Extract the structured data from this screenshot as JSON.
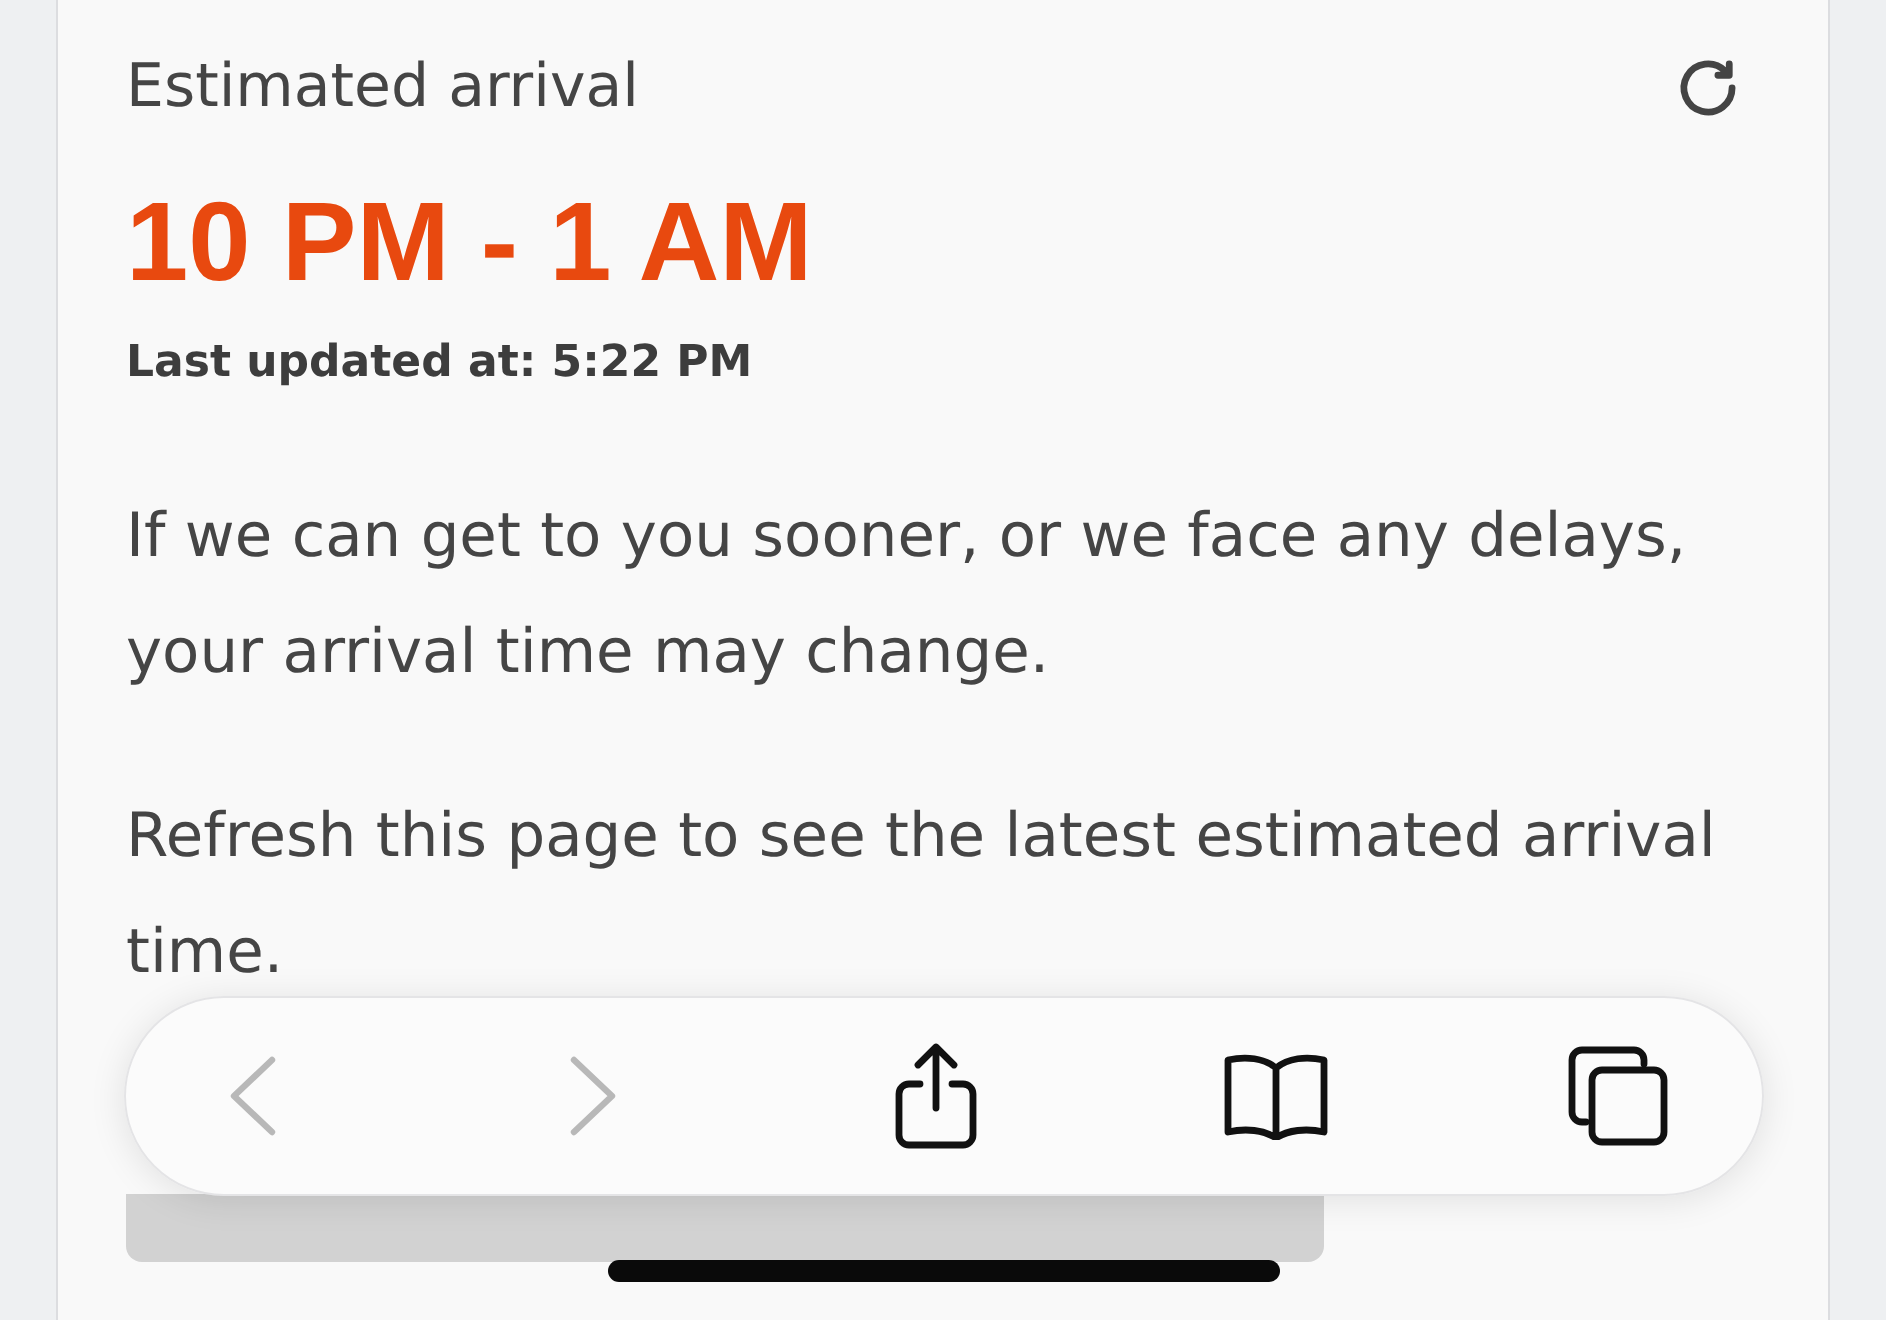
{
  "card": {
    "title": "Estimated arrival",
    "arrival_window": "10 PM - 1 AM",
    "last_updated": "Last updated at: 5:22 PM",
    "paragraphs": [
      "If we can get to you sooner, or we face any delays, your arrival time may change.",
      "Refresh this page to see the latest estimated arrival time."
    ]
  },
  "browser_toolbar": {
    "buttons": [
      {
        "kind": "back",
        "disabled": true
      },
      {
        "kind": "forward",
        "disabled": true
      },
      {
        "kind": "share",
        "disabled": false
      },
      {
        "kind": "bookmarks",
        "disabled": false
      },
      {
        "kind": "tabs",
        "disabled": false
      }
    ]
  }
}
